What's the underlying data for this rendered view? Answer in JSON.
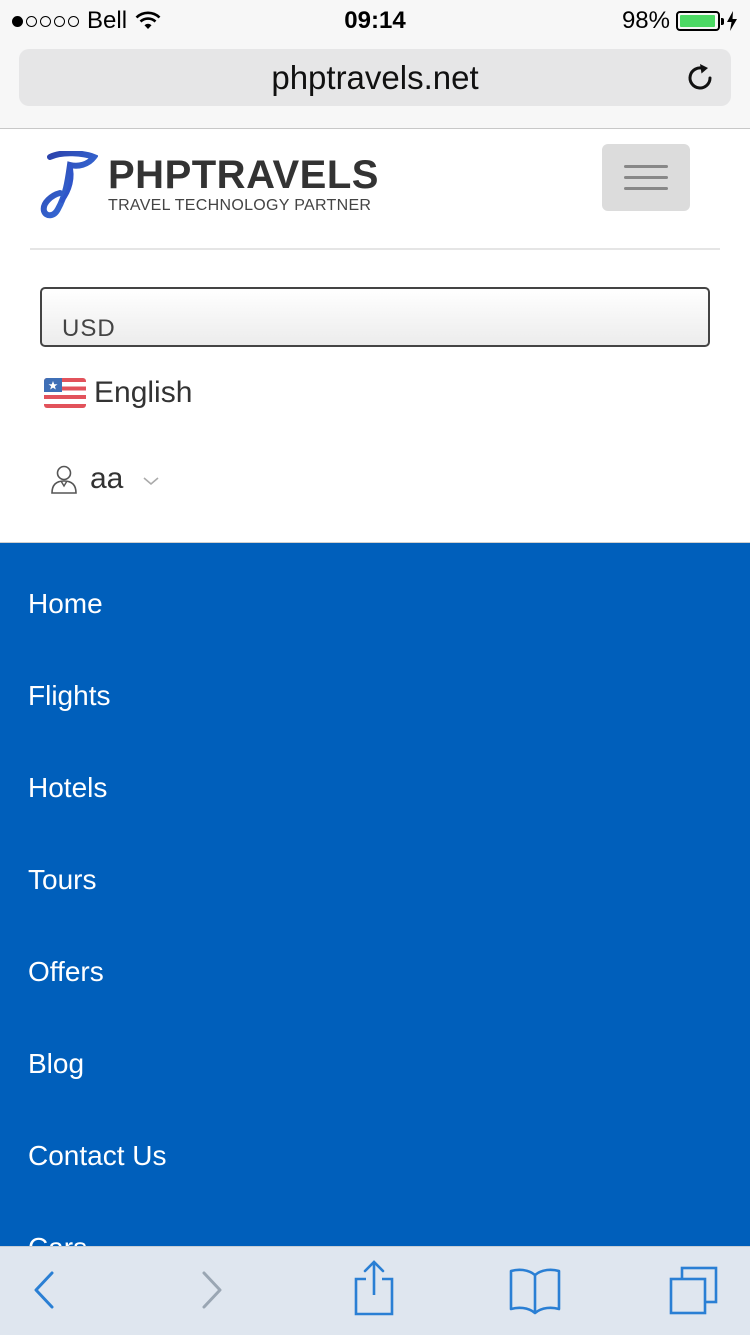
{
  "status_bar": {
    "carrier": "Bell",
    "time": "09:14",
    "battery_percent": "98%",
    "battery_level": 0.98,
    "signal_bars_filled": 1,
    "signal_bars_total": 5
  },
  "browser": {
    "url": "phptravels.net",
    "reload_icon": "reload-icon"
  },
  "header": {
    "logo_title": "PHPTRAVELS",
    "logo_subtitle": "TRAVEL TECHNOLOGY PARTNER",
    "menu_icon": "hamburger-icon"
  },
  "settings": {
    "currency": "USD",
    "language": "English",
    "user_name": "aa"
  },
  "nav": {
    "items": [
      {
        "label": "Home"
      },
      {
        "label": "Flights"
      },
      {
        "label": "Hotels"
      },
      {
        "label": "Tours"
      },
      {
        "label": "Offers"
      },
      {
        "label": "Blog"
      },
      {
        "label": "Contact Us"
      },
      {
        "label": "Cars"
      }
    ]
  },
  "toolbar": {
    "icons": [
      "back-icon",
      "forward-icon",
      "share-icon",
      "bookmarks-icon",
      "tabs-icon"
    ]
  },
  "colors": {
    "nav_background": "#005fbb",
    "toolbar_background": "#dfe6ef",
    "toolbar_icon": "#2a7fd4",
    "battery": "#4cd964"
  }
}
